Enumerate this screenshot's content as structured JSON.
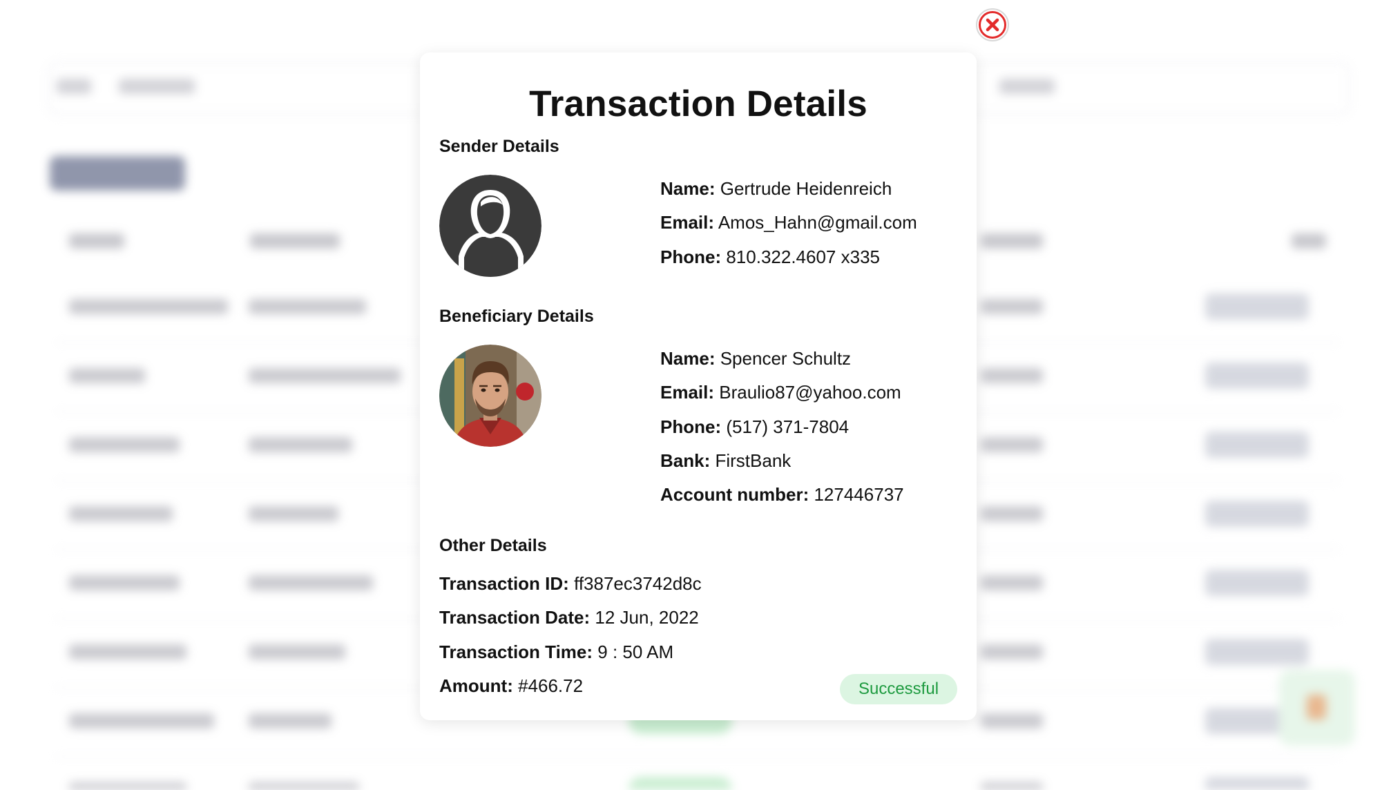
{
  "modal": {
    "title": "Transaction Details",
    "sender": {
      "heading": "Sender Details",
      "name_label": "Name:",
      "name": "Gertrude Heidenreich",
      "email_label": "Email:",
      "email": "Amos_Hahn@gmail.com",
      "phone_label": "Phone:",
      "phone": "810.322.4607 x335"
    },
    "beneficiary": {
      "heading": "Beneficiary Details",
      "name_label": "Name:",
      "name": "Spencer Schultz",
      "email_label": "Email:",
      "email": "Braulio87@yahoo.com",
      "phone_label": "Phone:",
      "phone": "(517) 371-7804",
      "bank_label": "Bank:",
      "bank": "FirstBank",
      "account_label": "Account number:",
      "account": "127446737"
    },
    "other": {
      "heading": "Other Details",
      "txn_id_label": "Transaction ID:",
      "txn_id": "ff387ec3742d8c",
      "txn_date_label": "Transaction Date:",
      "txn_date": "12 Jun, 2022",
      "txn_time_label": "Transaction Time:",
      "txn_time": "9 : 50 AM",
      "amount_label": "Amount:",
      "amount": "#466.72"
    },
    "status": "Successful",
    "close_icon": "close-x-circle-icon"
  },
  "colors": {
    "status_bg": "#dcf5e2",
    "status_text": "#1d9a3f",
    "close_red": "#e32b2b"
  }
}
